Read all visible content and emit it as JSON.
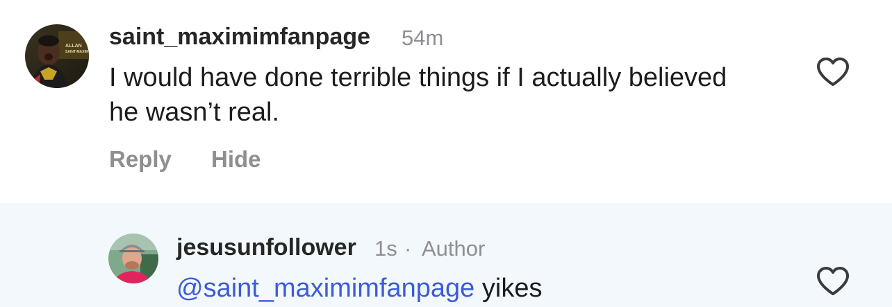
{
  "comments": [
    {
      "username": "saint_maximimfanpage",
      "time": "54m",
      "text": "I would have done terrible things if I actually believed he wasn’t real.",
      "avatar_text": [
        "ALLAN",
        "SAINT-MAXIM"
      ],
      "actions": {
        "reply": "Reply",
        "hide": "Hide"
      },
      "like_icon": "heart-outline-icon"
    },
    {
      "username": "jesusunfollower",
      "time": "1s",
      "separator": "·",
      "role": "Author",
      "mention": "@saint_maximimfanpage",
      "text": "yikes",
      "like_icon": "heart-outline-icon"
    }
  ],
  "colors": {
    "text": "#1c1c1e",
    "secondary": "#8e8e93",
    "mention": "#3b5bdb",
    "reply_background": "#f3f8fc"
  }
}
